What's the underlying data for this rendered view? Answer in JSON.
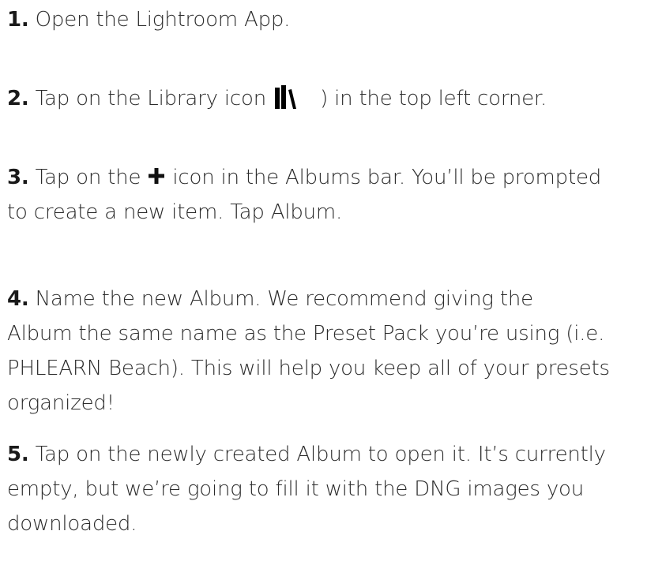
{
  "steps": [
    {
      "number": "1.",
      "text": " Open the Lightroom App."
    },
    {
      "number": "2.",
      "text_before_icon": " Tap on the Library icon ",
      "icon": "library-icon",
      "text_after_icon": ") in the top left corner."
    },
    {
      "number": "3.",
      "text_before_icon": " Tap on the ",
      "icon": "plus-icon",
      "text_after_icon": " icon in the Albums bar. You’ll be prompted",
      "line2": "to create a new item. Tap Album."
    },
    {
      "number": "4.",
      "line1": " Name the new Album. We recommend giving the",
      "line2": "Album the same name as the Preset Pack you’re using (i.e.",
      "line3": "PHLEARN Beach). This will help you keep all of your presets",
      "line4": "organized!"
    },
    {
      "number": "5.",
      "line1": " Tap on the newly created Album to open it. It’s currently",
      "line2": "empty, but we’re going to fill it with the DNG images you",
      "line3": "downloaded."
    }
  ]
}
